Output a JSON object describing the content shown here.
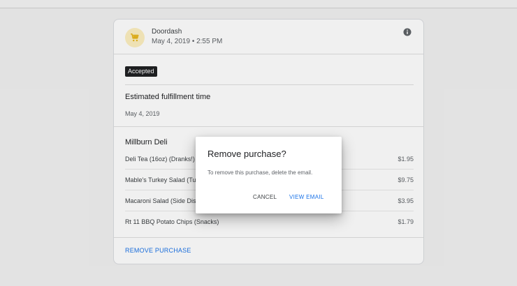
{
  "purchase": {
    "merchant": "Doordash",
    "date": "May 4, 2019 • 2:55 PM",
    "avatar_icon": "shopping-cart-icon",
    "status": "Accepted",
    "fulfillment_label": "Estimated fulfillment time",
    "fulfillment_date": "May 4, 2019",
    "store_name": "Millburn Deli",
    "items": [
      {
        "name": "Deli Tea (16oz) (Dranks!)",
        "price": "$1.95"
      },
      {
        "name": "Mable's Turkey Salad (Turkey)",
        "price": "$9.75"
      },
      {
        "name": "Macaroni Salad (Side Dishes)",
        "price": "$3.95"
      },
      {
        "name": "Rt 11 BBQ Potato Chips (Snacks)",
        "price": "$1.79"
      }
    ],
    "remove_label": "REMOVE PURCHASE"
  },
  "dialog": {
    "title": "Remove purchase?",
    "message": "To remove this purchase, delete the email.",
    "cancel_label": "CANCEL",
    "view_email_label": "VIEW EMAIL"
  },
  "colors": {
    "accent": "#1a73e8",
    "badge_bg": "#202124",
    "avatar_bg": "#fdf0c0",
    "cart_icon": "#f2c01a"
  }
}
